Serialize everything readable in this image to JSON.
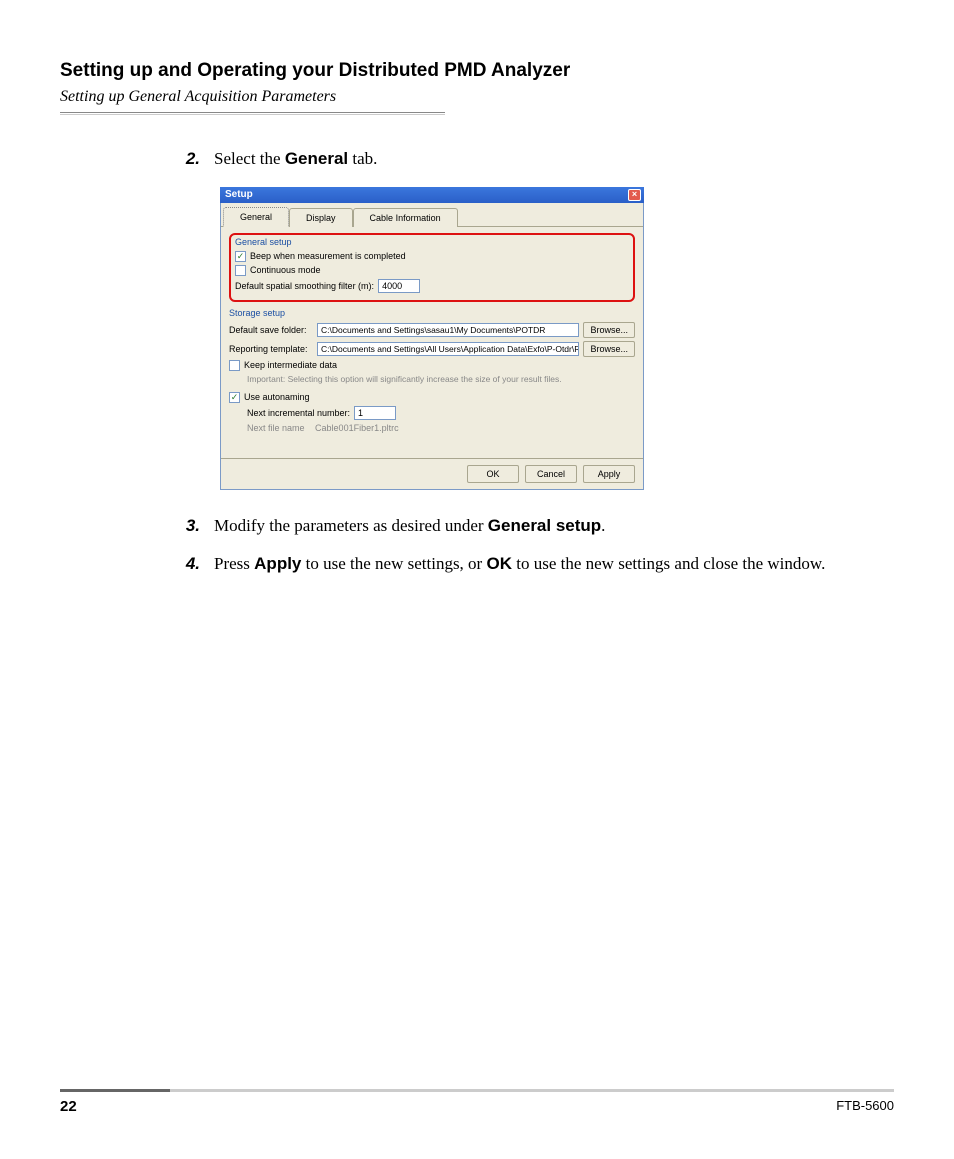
{
  "heading": "Setting up and Operating your Distributed PMD Analyzer",
  "subheading": "Setting up General Acquisition Parameters",
  "steps": {
    "s2_num": "2.",
    "s2_a": "Select the ",
    "s2_b": "General",
    "s2_c": " tab.",
    "s3_num": "3.",
    "s3_a": "Modify the parameters as desired under ",
    "s3_b": "General setup",
    "s3_c": ".",
    "s4_num": "4.",
    "s4_a": "Press ",
    "s4_b": "Apply",
    "s4_c": " to use the new settings, or ",
    "s4_d": "OK",
    "s4_e": " to use the new settings and close the window."
  },
  "dialog": {
    "title": "Setup",
    "tabs": {
      "general": "General",
      "display": "Display",
      "cable": "Cable Information"
    },
    "general_setup_title": "General setup",
    "beep_label": "Beep when measurement is completed",
    "continuous_label": "Continuous mode",
    "filter_label": "Default spatial smoothing filter (m):",
    "filter_value": "4000",
    "storage_title": "Storage setup",
    "save_folder_label": "Default save folder:",
    "save_folder_value": "C:\\Documents and Settings\\sasau1\\My Documents\\POTDR",
    "template_label": "Reporting template:",
    "template_value": "C:\\Documents and Settings\\All Users\\Application Data\\Exfo\\P-Otdr\\Report",
    "browse": "Browse...",
    "keep_label": "Keep intermediate data",
    "important": "Important: Selecting this option will significantly increase the size of your result files.",
    "autonaming_label": "Use autonaming",
    "next_inc_label": "Next incremental number:",
    "next_inc_value": "1",
    "next_file_label": "Next file name",
    "next_file_value": "Cable001Fiber1.pltrc",
    "ok": "OK",
    "cancel": "Cancel",
    "apply": "Apply"
  },
  "footer": {
    "page": "22",
    "model": "FTB-5600"
  }
}
